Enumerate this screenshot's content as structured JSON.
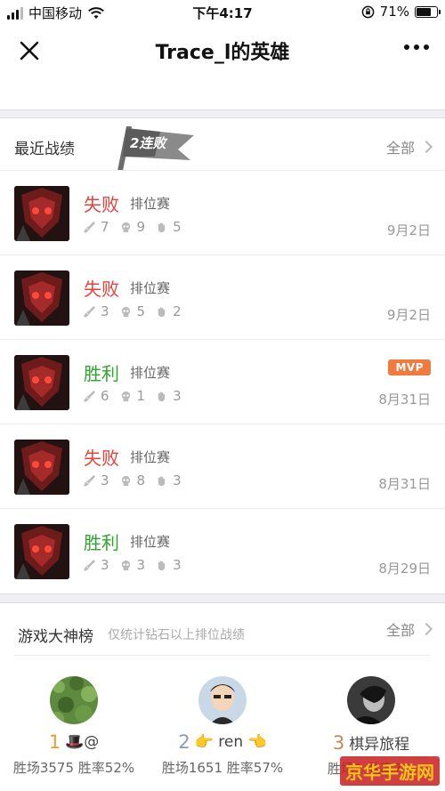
{
  "status": {
    "carrier": "中国移动",
    "time": "下午4:17",
    "battery": "71%",
    "battery_level": 0.71
  },
  "nav": {
    "title": "Trace_l的英雄"
  },
  "recent": {
    "title": "最近战绩",
    "streak": "2连败",
    "more": "全部",
    "matches": [
      {
        "result": "失败",
        "result_type": "lose",
        "mode": "排位赛",
        "kills": "7",
        "deaths": "9",
        "assists": "5",
        "date": "9月2日",
        "mvp": ""
      },
      {
        "result": "失败",
        "result_type": "lose",
        "mode": "排位赛",
        "kills": "3",
        "deaths": "5",
        "assists": "2",
        "date": "9月2日",
        "mvp": ""
      },
      {
        "result": "胜利",
        "result_type": "win",
        "mode": "排位赛",
        "kills": "6",
        "deaths": "1",
        "assists": "3",
        "date": "8月31日",
        "mvp": "MVP"
      },
      {
        "result": "失败",
        "result_type": "lose",
        "mode": "排位赛",
        "kills": "3",
        "deaths": "8",
        "assists": "3",
        "date": "8月31日",
        "mvp": ""
      },
      {
        "result": "胜利",
        "result_type": "win",
        "mode": "排位赛",
        "kills": "3",
        "deaths": "3",
        "assists": "3",
        "date": "8月29日",
        "mvp": ""
      }
    ]
  },
  "leaderboard": {
    "title": "游戏大神榜",
    "subtitle": "仅统计钻石以上排位战绩",
    "more": "全部",
    "players": [
      {
        "rank": "1",
        "name": "🎩@",
        "stats": "胜场3575 胜率52%"
      },
      {
        "rank": "2",
        "name": "👉 ren 👈",
        "stats": "胜场1651 胜率57%"
      },
      {
        "rank": "3",
        "name": "棋异旅程",
        "stats": "胜场1 胜率7%"
      }
    ]
  },
  "watermark": "京华手游网"
}
